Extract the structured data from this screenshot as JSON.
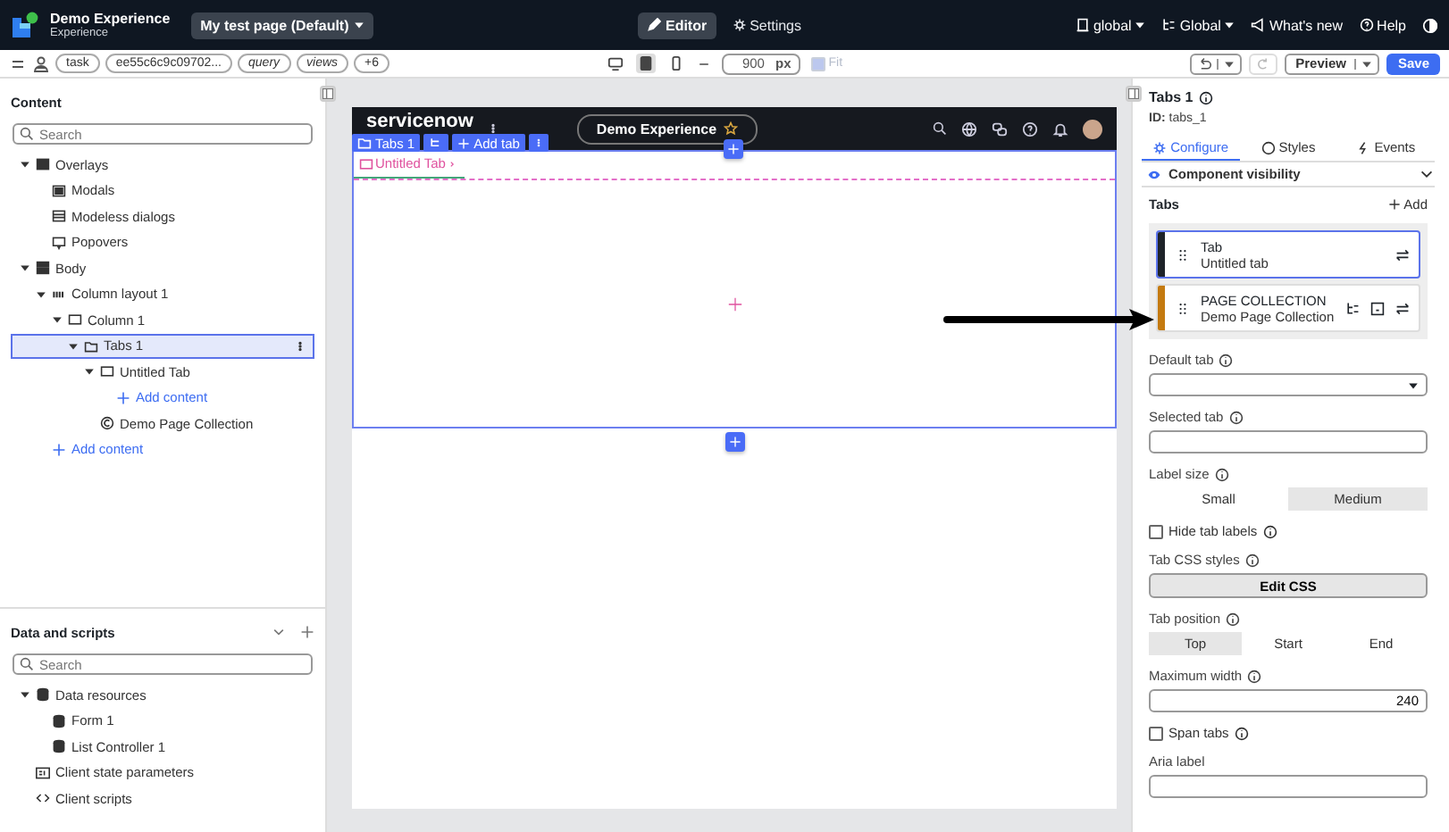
{
  "topbar": {
    "app_title": "Demo Experience",
    "app_subtitle": "Experience",
    "page_menu": "My test page (Default)",
    "modes": [
      {
        "label": "Editor",
        "selected": true
      },
      {
        "label": "Settings",
        "selected": false
      }
    ],
    "menus": [
      {
        "kind": "scope",
        "label": "global"
      },
      {
        "kind": "app",
        "label": "Global"
      },
      {
        "kind": "news",
        "label": "What's new"
      },
      {
        "kind": "help",
        "label": "Help"
      }
    ]
  },
  "toolbar": {
    "chips": [
      {
        "label": "task",
        "italic": false
      },
      {
        "label": "ee55c6c9c09702...",
        "italic": false
      },
      {
        "label": "query",
        "italic": true
      },
      {
        "label": "views",
        "italic": true
      },
      {
        "label": "+6",
        "italic": false
      }
    ],
    "devices": [
      {
        "kind": "desktop",
        "selected": false
      },
      {
        "kind": "tablet",
        "selected": true
      },
      {
        "kind": "mobile",
        "selected": false
      }
    ],
    "width_value": "900",
    "width_unit": "px",
    "fit": {
      "label": "Fit",
      "checked": true,
      "disabled": true
    },
    "preview": "Preview",
    "save": "Save"
  },
  "content_panel": {
    "title": "Content",
    "search_placeholder": "Search",
    "tree": [
      {
        "label": "Overlays",
        "kind": "overlay",
        "expanded": true,
        "selected": false,
        "children": [
          {
            "label": "Modals",
            "kind": "modal",
            "selected": false
          },
          {
            "label": "Modeless dialogs",
            "kind": "dialog",
            "selected": false
          },
          {
            "label": "Popovers",
            "kind": "popover",
            "selected": false
          }
        ]
      },
      {
        "label": "Body",
        "kind": "body",
        "expanded": true,
        "selected": false,
        "children": [
          {
            "label": "Column layout 1",
            "kind": "layout",
            "expanded": true,
            "selected": false,
            "children": [
              {
                "label": "Column 1",
                "kind": "column",
                "expanded": true,
                "selected": false,
                "children": [
                  {
                    "label": "Tabs 1",
                    "kind": "tabs",
                    "expanded": true,
                    "selected": true,
                    "children": [
                      {
                        "label": "Untitled Tab",
                        "kind": "column",
                        "expanded": true,
                        "selected": false,
                        "children": [
                          {
                            "label": "Add content",
                            "kind": "add",
                            "selected": false
                          }
                        ]
                      },
                      {
                        "label": "Demo Page Collection",
                        "kind": "collection",
                        "selected": false
                      }
                    ]
                  }
                ]
              }
            ]
          },
          {
            "label": "Add content",
            "kind": "add",
            "selected": false
          }
        ]
      }
    ]
  },
  "data_panel": {
    "title": "Data and scripts",
    "search_placeholder": "Search",
    "tree": [
      {
        "label": "Data resources",
        "kind": "data",
        "expanded": true,
        "selected": false,
        "children": [
          {
            "label": "Form 1",
            "kind": "data",
            "selected": false
          },
          {
            "label": "List Controller 1",
            "kind": "data",
            "selected": false
          }
        ]
      },
      {
        "label": "Client state parameters",
        "kind": "params",
        "selected": false
      },
      {
        "label": "Client scripts",
        "kind": "scripts",
        "selected": false
      }
    ]
  },
  "canvas": {
    "logo": "servicenow",
    "title": "Demo Experience",
    "overlay_tools": [
      {
        "kind": "name",
        "label": "Tabs 1"
      },
      {
        "kind": "tree"
      },
      {
        "kind": "add",
        "label": "Add tab"
      },
      {
        "kind": "more"
      }
    ],
    "tab_label": "Untitled Tab"
  },
  "inspector": {
    "title": "Tabs 1",
    "id": "**ID:** tabs_1",
    "tabs": [
      {
        "kind": "configure",
        "label": "Configure",
        "selected": true
      },
      {
        "kind": "styles",
        "label": "Styles",
        "selected": false
      },
      {
        "kind": "events",
        "label": "Events",
        "selected": false
      }
    ],
    "visibility": "Component visibility",
    "tabs_section": {
      "title": "Tabs",
      "add": "Add",
      "items": [
        {
          "kind": "tab",
          "type": "Tab",
          "name": "Untitled tab",
          "color": "#1e2329",
          "selected": true
        },
        {
          "kind": "collection",
          "type": "PAGE COLLECTION",
          "name": "Demo Page Collection",
          "color": "#c47a10",
          "selected": false
        }
      ]
    },
    "fields": [
      {
        "kind": "select",
        "label": "Default tab",
        "info": true
      },
      {
        "kind": "input",
        "label": "Selected tab",
        "info": true
      },
      {
        "kind": "segmented",
        "label": "Label size",
        "info": true,
        "options": [
          {
            "label": "Small",
            "selected": false
          },
          {
            "label": "Medium",
            "selected": true
          }
        ]
      },
      {
        "kind": "checkbox",
        "label": "Hide tab labels",
        "info": true,
        "checked": false
      },
      {
        "kind": "button",
        "label": "Tab CSS styles",
        "info": true,
        "button": "Edit CSS"
      },
      {
        "kind": "segmented",
        "label": "Tab position",
        "info": true,
        "options": [
          {
            "label": "Top",
            "selected": true
          },
          {
            "label": "Start",
            "selected": false
          },
          {
            "label": "End",
            "selected": false
          }
        ]
      },
      {
        "kind": "input",
        "label": "Maximum width",
        "info": true,
        "value": "240"
      },
      {
        "kind": "checkbox",
        "label": "Span tabs",
        "info": true,
        "checked": false
      },
      {
        "kind": "input",
        "label": "Aria label",
        "info": false
      }
    ]
  }
}
